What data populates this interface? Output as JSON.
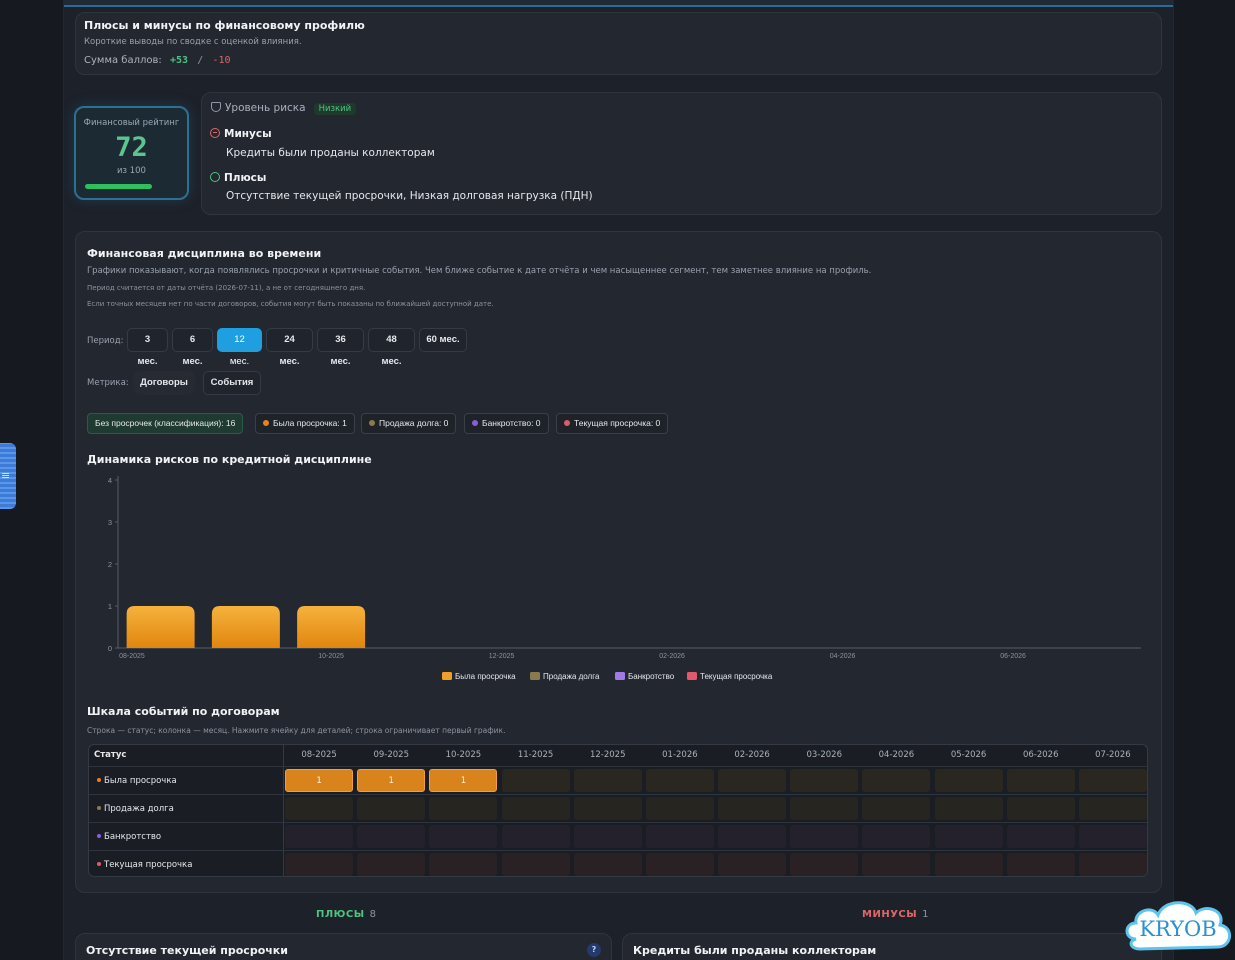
{
  "sidebar": {
    "tab_icon": "≡"
  },
  "summary": {
    "title": "Плюсы и минусы по финансовому профилю",
    "subtitle": "Короткие выводы по сводке с оценкой влияния.",
    "score_label": "Сумма баллов:",
    "score_plus": "+53",
    "score_sep": "/",
    "score_minus": "-10"
  },
  "rating": {
    "label": "Финансовый рейтинг",
    "value": "72",
    "of": "из 100",
    "fill_percent": 72
  },
  "risk": {
    "label": "Уровень риска",
    "badge": "Низкий",
    "minus_title": "Минусы",
    "minus_text": "Кредиты были проданы коллекторам",
    "plus_title": "Плюсы",
    "plus_text": "Отсутствие текущей просрочки, Низкая долговая нагрузка (ПДН)"
  },
  "discipline": {
    "title": "Финансовая дисциплина во времени",
    "subtitle": "Графики показывают, когда появлялись просрочки и критичные события. Чем ближе событие к дате отчёта и чем насыщеннее сегмент, тем заметнее влияние на профиль.",
    "note1": "Период считается от даты отчёта (2026-07-11), а не от сегодняшнего дня.",
    "note2": "Если точных месяцев нет по части договоров, события могут быть показаны по ближайшей доступной дате.",
    "period_label": "Период:",
    "periods": [
      "3 мес.",
      "6 мес.",
      "12 мес.",
      "24 мес.",
      "36 мес.",
      "48 мес.",
      "60 мес."
    ],
    "active_period": "12 мес.",
    "metric_label": "Метрика:",
    "metrics": [
      "Договоры",
      "События"
    ],
    "chips": [
      {
        "label": "Без просрочек (классификация): 16",
        "color": ""
      },
      {
        "label": "Была просрочка: 1",
        "color": "#e8821a"
      },
      {
        "label": "Продажа долга: 0",
        "color": "#8a7a4e"
      },
      {
        "label": "Банкротство: 0",
        "color": "#8a5ce0"
      },
      {
        "label": "Текущая просрочка: 0",
        "color": "#e05a6a"
      }
    ]
  },
  "chart_data": {
    "type": "bar",
    "title": "Динамика рисков по кредитной дисциплине",
    "categories": [
      "08-2025",
      "09-2025",
      "10-2025",
      "11-2025",
      "12-2025",
      "01-2026",
      "02-2026",
      "03-2026",
      "04-2026",
      "05-2026",
      "06-2026",
      "07-2026"
    ],
    "tick_labels": [
      "08-2025",
      "10-2025",
      "12-2025",
      "02-2026",
      "04-2026",
      "06-2026"
    ],
    "series": [
      {
        "name": "Была просрочка",
        "color": "#f0a028",
        "values": [
          1,
          1,
          1,
          0,
          0,
          0,
          0,
          0,
          0,
          0,
          0,
          0
        ]
      },
      {
        "name": "Продажа долга",
        "color": "#8a7a4e",
        "values": [
          0,
          0,
          0,
          0,
          0,
          0,
          0,
          0,
          0,
          0,
          0,
          0
        ]
      },
      {
        "name": "Банкротство",
        "color": "#a27ae8",
        "values": [
          0,
          0,
          0,
          0,
          0,
          0,
          0,
          0,
          0,
          0,
          0,
          0
        ]
      },
      {
        "name": "Текущая просрочка",
        "color": "#e05a6a",
        "values": [
          0,
          0,
          0,
          0,
          0,
          0,
          0,
          0,
          0,
          0,
          0,
          0
        ]
      }
    ],
    "ylim": [
      0,
      4
    ],
    "yticks": [
      0,
      1,
      2,
      3,
      4
    ],
    "legend": "bottom-center",
    "grid": false
  },
  "timeline": {
    "title": "Шкала событий по договорам",
    "subtitle": "Строка — статус; колонка — месяц. Нажмите ячейку для деталей; строка ограничивает первый график.",
    "status_header": "Статус",
    "months": [
      "08-2025",
      "09-2025",
      "10-2025",
      "11-2025",
      "12-2025",
      "01-2026",
      "02-2026",
      "03-2026",
      "04-2026",
      "05-2026",
      "06-2026",
      "07-2026"
    ],
    "rows": [
      {
        "label": "Была просрочка",
        "dot": "#e8821a",
        "values": [
          "1",
          "1",
          "1",
          "",
          "",
          "",
          "",
          "",
          "",
          "",
          "",
          ""
        ]
      },
      {
        "label": "Продажа долга",
        "dot": "#8a7a4e",
        "values": [
          "",
          "",
          "",
          "",
          "",
          "",
          "",
          "",
          "",
          "",
          "",
          ""
        ]
      },
      {
        "label": "Банкротство",
        "dot": "#8a5ce0",
        "values": [
          "",
          "",
          "",
          "",
          "",
          "",
          "",
          "",
          "",
          "",
          "",
          ""
        ]
      },
      {
        "label": "Текущая просрочка",
        "dot": "#e05a6a",
        "values": [
          "",
          "",
          "",
          "",
          "",
          "",
          "",
          "",
          "",
          "",
          "",
          ""
        ]
      }
    ]
  },
  "bottom": {
    "plus_label": "ПЛЮСЫ",
    "plus_count": "8",
    "minus_label": "МИНУСЫ",
    "minus_count": "1",
    "plus_card_title": "Отсутствие текущей просрочки",
    "minus_card_title": "Кредиты были проданы коллекторам",
    "help_badge": "?"
  },
  "logo": {
    "text": "KRYOB"
  },
  "colors": {
    "accent": "#1f9fe0",
    "positive": "#4fc27f",
    "negative": "#e06767",
    "bar": "#f0a028"
  }
}
